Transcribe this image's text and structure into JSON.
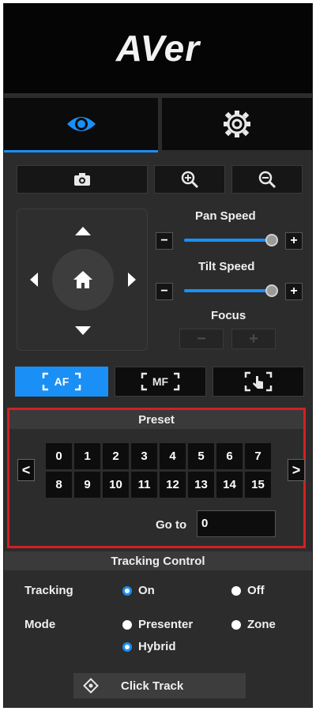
{
  "brand": {
    "logo_text": "AVer"
  },
  "tabs": [
    {
      "icon": "eye-icon",
      "active": true
    },
    {
      "icon": "gear-icon",
      "active": false
    }
  ],
  "camera_controls": {
    "snapshot_icon": "camera-icon",
    "zoom_in_icon": "zoom-in-icon",
    "zoom_out_icon": "zoom-out-icon"
  },
  "ptz": {
    "pan_speed_label": "Pan Speed",
    "tilt_speed_label": "Tilt Speed",
    "focus_label": "Focus",
    "pan_speed_level": 1.0,
    "tilt_speed_level": 1.0,
    "minus": "−",
    "plus": "+"
  },
  "focus_modes": [
    {
      "label": "AF",
      "active": true
    },
    {
      "label": "MF",
      "active": false
    },
    {
      "label": "touch-focus-icon",
      "active": false
    }
  ],
  "preset": {
    "title": "Preset",
    "row1": [
      "0",
      "1",
      "2",
      "3",
      "4",
      "5",
      "6",
      "7"
    ],
    "row2": [
      "8",
      "9",
      "10",
      "11",
      "12",
      "13",
      "14",
      "15"
    ],
    "prev": "<",
    "next": ">",
    "goto_label": "Go to",
    "goto_value": "0"
  },
  "tracking": {
    "title": "Tracking Control",
    "tracking_label": "Tracking",
    "on_label": "On",
    "off_label": "Off",
    "mode_label": "Mode",
    "presenter_label": "Presenter",
    "zone_label": "Zone",
    "hybrid_label": "Hybrid",
    "click_track_label": "Click Track"
  },
  "colors": {
    "accent": "#1a8ff5",
    "highlight": "#d42020"
  }
}
